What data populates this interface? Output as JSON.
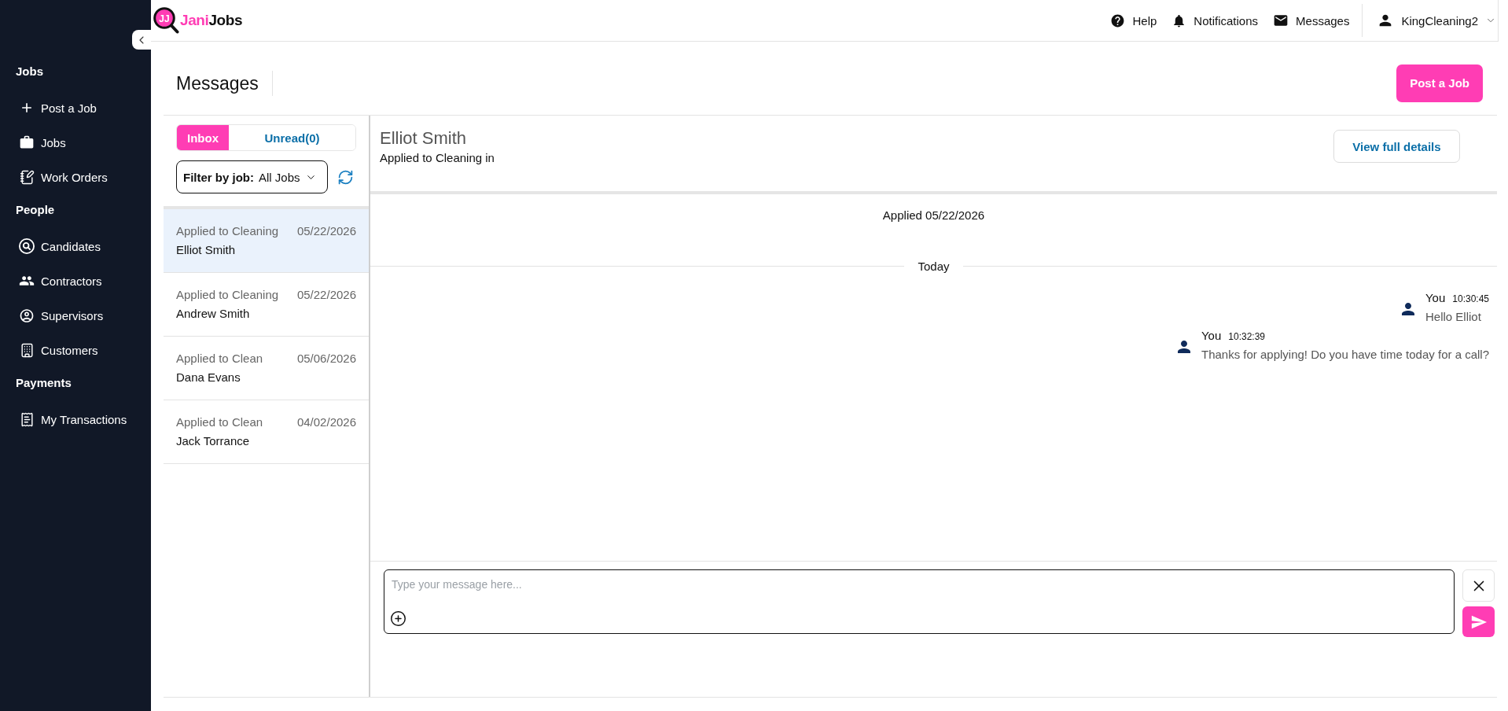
{
  "logo": {
    "mark": "JJ",
    "first": "Jani",
    "second": "Jobs"
  },
  "sidebar": {
    "sections": [
      {
        "title": "Jobs",
        "items": [
          {
            "label": "Post a Job"
          },
          {
            "label": "Jobs"
          },
          {
            "label": "Work Orders"
          }
        ]
      },
      {
        "title": "People",
        "items": [
          {
            "label": "Candidates"
          },
          {
            "label": "Contractors"
          },
          {
            "label": "Supervisors"
          },
          {
            "label": "Customers"
          }
        ]
      },
      {
        "title": "Payments",
        "items": [
          {
            "label": "My Transactions"
          }
        ]
      }
    ]
  },
  "topbar": {
    "links": [
      {
        "label": "Help"
      },
      {
        "label": "Notifications"
      },
      {
        "label": "Messages"
      }
    ],
    "user": "KingCleaning2"
  },
  "page": {
    "title": "Messages",
    "action": "Post a Job"
  },
  "inbox": {
    "tabs": [
      {
        "label": "Inbox",
        "selected": true
      },
      {
        "label": "Unread(0)",
        "selected": false
      }
    ],
    "filter": {
      "label": "Filter by job:",
      "value": "All Jobs"
    },
    "conversations": [
      {
        "job": "Applied to Cleaning",
        "date": "05/22/2026",
        "name": "Elliot Smith",
        "selected": true
      },
      {
        "job": "Applied to Cleaning",
        "date": "05/22/2026",
        "name": "Andrew Smith",
        "selected": false
      },
      {
        "job": "Applied to Clean",
        "date": "05/06/2026",
        "name": "Dana Evans",
        "selected": false
      },
      {
        "job": "Applied to Clean",
        "date": "04/02/2026",
        "name": "Jack Torrance",
        "selected": false
      }
    ]
  },
  "chat": {
    "name": "Elliot Smith",
    "subtitle": "Applied to Cleaning in",
    "details_button": "View full details",
    "event": "Applied 05/22/2026",
    "divider": "Today",
    "messages": [
      {
        "sender": "You",
        "time": "10:30:45",
        "text": "Hello Elliot"
      },
      {
        "sender": "You",
        "time": "10:32:39",
        "text": "Thanks for applying! Do you have time today for a call?"
      }
    ],
    "composer": {
      "placeholder": "Type your message here..."
    }
  }
}
